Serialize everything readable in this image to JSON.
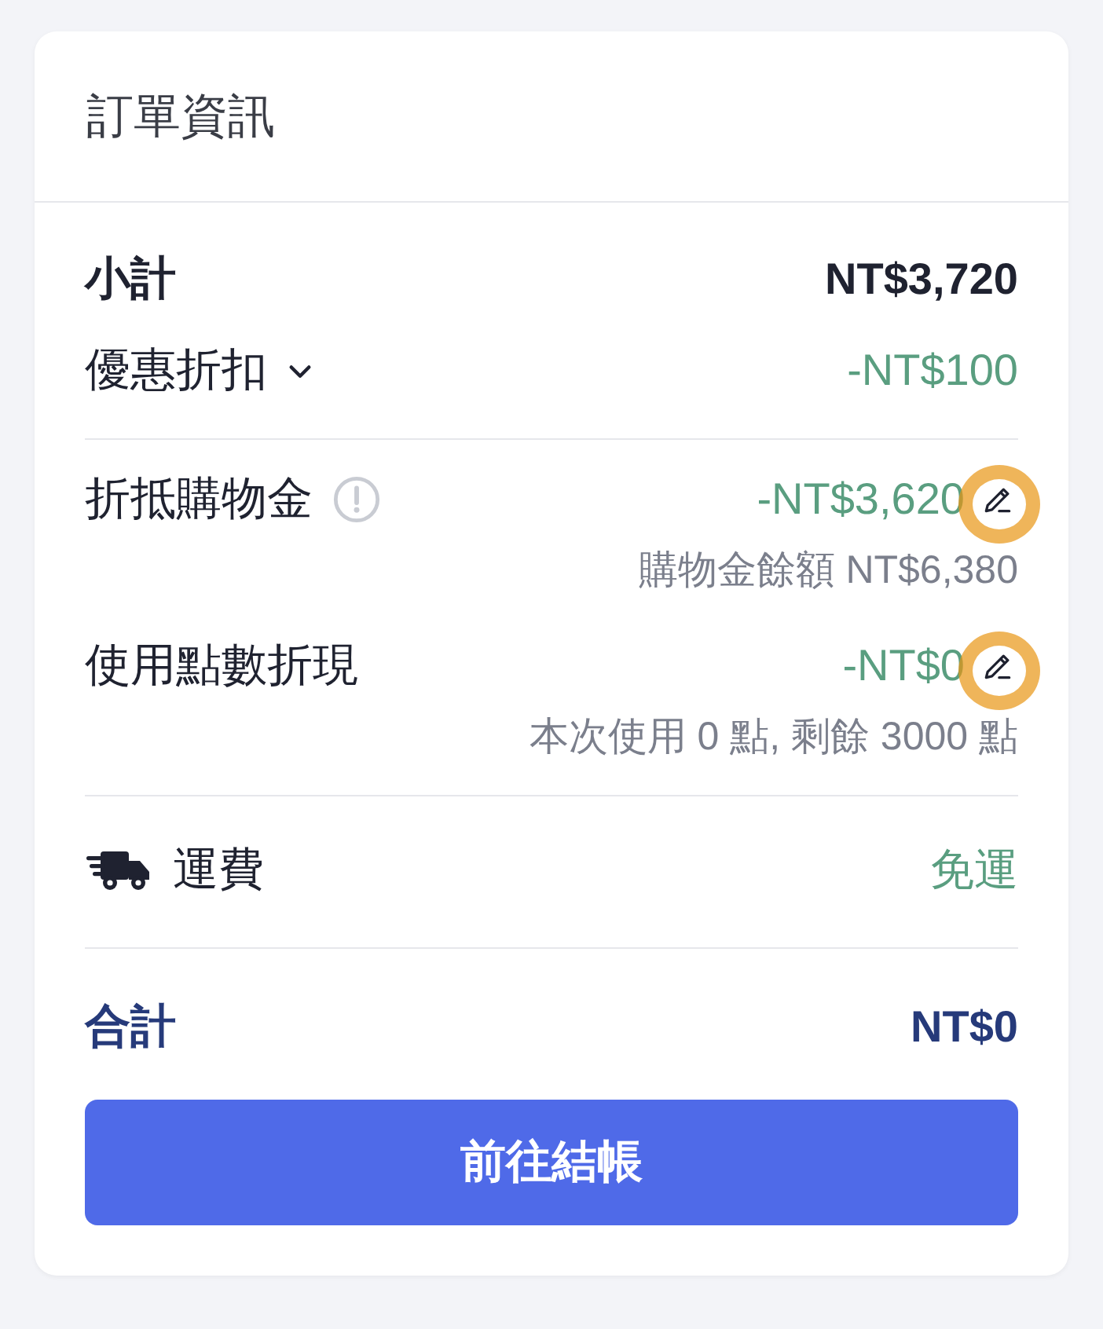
{
  "header": {
    "title": "訂單資訊"
  },
  "subtotal": {
    "label": "小計",
    "amount": "NT$3,720"
  },
  "discount": {
    "label": "優惠折扣",
    "expanded": false,
    "amount": "-NT$100"
  },
  "adjustments": [
    {
      "label": "折抵購物金",
      "info": true,
      "amount": "-NT$3,620",
      "note": "購物金餘額 NT$6,380",
      "highlighted": true
    },
    {
      "label": "使用點數折現",
      "info": false,
      "amount": "-NT$0",
      "note": "本次使用 0 點, 剩餘 3000 點",
      "highlighted": true
    }
  ],
  "shipping": {
    "label": "運費",
    "amount": "免運"
  },
  "total": {
    "label": "合計",
    "amount": "NT$0"
  },
  "checkout_button": "前往結帳"
}
